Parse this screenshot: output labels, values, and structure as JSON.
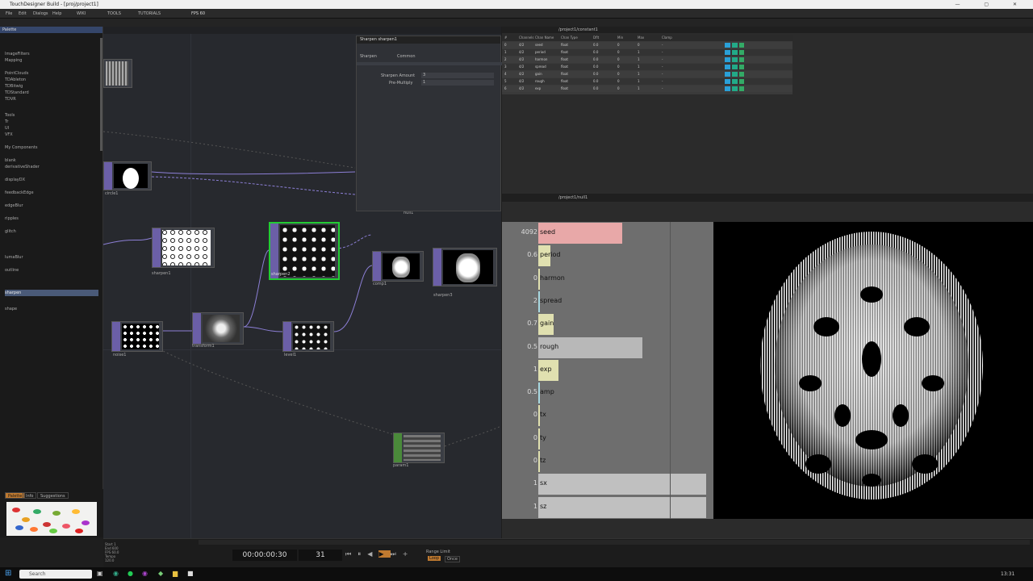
{
  "window": {
    "title": "TouchDesigner  Build  - [proj/project1]"
  },
  "menu": {
    "items": [
      "File",
      "Edit",
      "Dialogs",
      "Help",
      "WIKI",
      "TOOLS",
      "TUTORIALS",
      "FPS 60"
    ]
  },
  "palette": {
    "title": "Palette",
    "items": [
      "ImageFilters",
      "Mapping",
      "PointClouds",
      "TDAbleton",
      "TDBitwig",
      "TDStandard",
      "TDVR",
      "Tools",
      "Tr",
      "UI",
      "VFX",
      "My Components",
      "blank",
      "derivativeShader",
      "displayDX",
      "feedbackEdge",
      "edgeBlur",
      "ripples",
      "glitch",
      "lumaBlur",
      "outline",
      "sharpen",
      "shape"
    ],
    "selected_item": "sharpen",
    "tabs": [
      "Palette",
      "Info",
      "Suggestions"
    ]
  },
  "nodes": {
    "circle": "circle1",
    "sharpen_a": "sharpen1",
    "sharpen_b": "sharpen2",
    "noise": "noise1",
    "transform": "transform1",
    "level": "level1",
    "comp": "comp1",
    "sharpen_c": "sharpen3",
    "out": "null1",
    "chop": "param1"
  },
  "params": {
    "title": "Sharpen  sharpen1",
    "tabs": [
      "Sharpen",
      "Common"
    ],
    "fields": [
      {
        "label": "Sharpen Amount",
        "value": "3"
      },
      {
        "label": "Pre-Multiply",
        "value": "1"
      }
    ]
  },
  "table": {
    "path": "/project1/constant1",
    "headers": [
      "#",
      "Channels",
      "Chan Name",
      "Chan Type",
      "Dflt",
      "Min",
      "Max",
      "Clamp"
    ],
    "rows": [
      [
        "0",
        "4/2",
        "seed",
        "float",
        "0.0",
        "0",
        "0",
        "-"
      ],
      [
        "1",
        "4/2",
        "period",
        "float",
        "0.0",
        "0",
        "1",
        "-"
      ],
      [
        "2",
        "4/2",
        "harmon",
        "float",
        "0.0",
        "0",
        "1",
        "-"
      ],
      [
        "3",
        "4/2",
        "spread",
        "float",
        "0.0",
        "0",
        "1",
        "-"
      ],
      [
        "4",
        "4/2",
        "gain",
        "float",
        "0.0",
        "0",
        "1",
        "-"
      ],
      [
        "5",
        "4/2",
        "rough",
        "float",
        "0.0",
        "0",
        "1",
        "-"
      ],
      [
        "6",
        "4/2",
        "exp",
        "float",
        "0.0",
        "0",
        "1",
        "-"
      ]
    ]
  },
  "viewer": {
    "path": "/project1/null1",
    "channels": [
      {
        "label": "seed",
        "value": "4092",
        "fill": 0.5,
        "color": "#e8a8a8"
      },
      {
        "label": "period",
        "value": "0.6",
        "fill": 0.07,
        "color": "#e0e0b0"
      },
      {
        "label": "harmon",
        "value": "0",
        "fill": 0,
        "color": "#e0e0b0"
      },
      {
        "label": "spread",
        "value": "2",
        "fill": 0.01,
        "color": "#a8d8e0"
      },
      {
        "label": "gain",
        "value": "0.7",
        "fill": 0.09,
        "color": "#e0e0b0"
      },
      {
        "label": "rough",
        "value": "0.5",
        "fill": 0.62,
        "color": "#b8b8b8"
      },
      {
        "label": "exp",
        "value": "1",
        "fill": 0.12,
        "color": "#e0e0b0"
      },
      {
        "label": "amp",
        "value": "0.5",
        "fill": 0.005,
        "color": "#a8d8e0"
      },
      {
        "label": "tx",
        "value": "0",
        "fill": 0,
        "color": "#e0e0b0"
      },
      {
        "label": "ty",
        "value": "0",
        "fill": 0,
        "color": "#e0e0b0"
      },
      {
        "label": "tz",
        "value": "0",
        "fill": 0,
        "color": "#e0e0b0"
      },
      {
        "label": "sx",
        "value": "1",
        "fill": 1.0,
        "color": "#c0c0c0"
      },
      {
        "label": "sz",
        "value": "1",
        "fill": 1.0,
        "color": "#c0c0c0"
      }
    ]
  },
  "timeline": {
    "timecode": "00:00:00:30",
    "frame": "31",
    "range_label": "Range Limit",
    "loop": "Loop",
    "once": "Once",
    "stats": [
      {
        "k": "Start",
        "v": "1"
      },
      {
        "k": "End",
        "v": "600"
      },
      {
        "k": "FPS",
        "v": "60.0"
      },
      {
        "k": "Tempo",
        "v": "120.0"
      }
    ]
  },
  "taskbar": {
    "search_placeholder": "Search",
    "clock": "13:31"
  },
  "colors": {
    "accent": "#6b5fa7",
    "active": "#22cc33",
    "bg": "#27292e"
  }
}
